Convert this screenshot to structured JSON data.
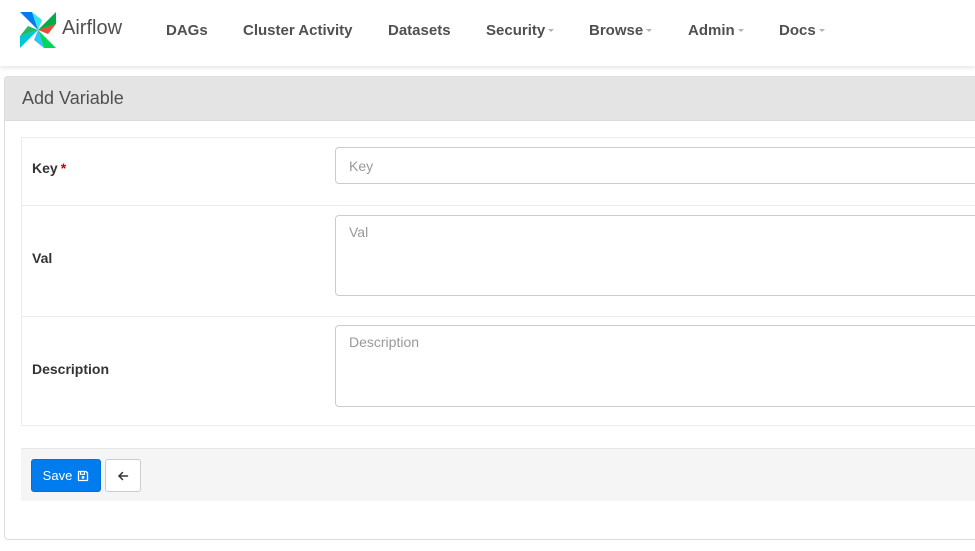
{
  "navbar": {
    "brand": "Airflow",
    "items": [
      {
        "label": "DAGs",
        "dropdown": false
      },
      {
        "label": "Cluster Activity",
        "dropdown": false
      },
      {
        "label": "Datasets",
        "dropdown": false
      },
      {
        "label": "Security",
        "dropdown": true
      },
      {
        "label": "Browse",
        "dropdown": true
      },
      {
        "label": "Admin",
        "dropdown": true
      },
      {
        "label": "Docs",
        "dropdown": true
      }
    ]
  },
  "panel": {
    "title": "Add Variable"
  },
  "form": {
    "key": {
      "label": "Key",
      "required_mark": "*",
      "placeholder": "Key",
      "value": ""
    },
    "val": {
      "label": "Val",
      "placeholder": "Val",
      "value": ""
    },
    "description": {
      "label": "Description",
      "placeholder": "Description",
      "value": ""
    }
  },
  "actions": {
    "save_label": "Save",
    "save_icon": "floppy-disk-icon",
    "back_icon": "arrow-left-icon"
  },
  "colors": {
    "primary": "#017cee",
    "heading_bg": "#e4e4e4",
    "required": "#cc0000",
    "nav_text": "#51504f"
  }
}
